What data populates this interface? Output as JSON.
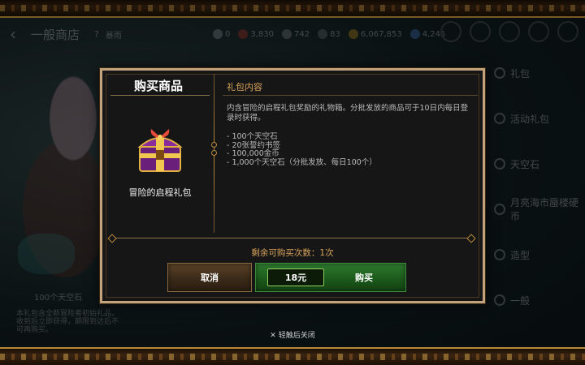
{
  "background": {
    "topbar": {
      "back_icon": "back-arrow-icon",
      "title": "一般商店",
      "help": "?",
      "tag": "暴雨",
      "currencies": [
        {
          "name": "mail",
          "value": "0",
          "color": "#9aa0a8"
        },
        {
          "name": "soul",
          "value": "3,830",
          "color": "#c0392b"
        },
        {
          "name": "ticket",
          "value": "742",
          "color": "#8e8e8e"
        },
        {
          "name": "stone",
          "value": "83",
          "color": "#6f7a80"
        },
        {
          "name": "gold",
          "value": "6,067,853",
          "color": "#d4a020"
        },
        {
          "name": "crystal",
          "value": "4,245",
          "color": "#4a88d8"
        }
      ]
    },
    "left_item": {
      "name": "100个天空石",
      "description": "本礼包含全新冒险者初始礼品，收到后立即获得，期限到达后不可再购买。"
    },
    "sidebar": {
      "items": [
        {
          "label": "礼包"
        },
        {
          "label": "活动礼包"
        },
        {
          "label": "天空石"
        },
        {
          "label": "月亮海市蜃楼硬币"
        },
        {
          "label": "造型"
        },
        {
          "label": "一般"
        }
      ]
    }
  },
  "dialog": {
    "title": "购买商品",
    "item_name": "冒险的启程礼包",
    "content_title": "礼包内容",
    "content_desc": "内含冒险的启程礼包奖励的礼物箱。分批发放的商品可于10日内每日登录时获得。",
    "content_items": [
      "- 100个天空石",
      "- 20张誓约书签",
      "- 100,000金币",
      "- 1,000个天空石（分批发放、每日100个）"
    ],
    "remaining": "剩余可购买次数：1次",
    "cancel_label": "取消",
    "price": "18元",
    "buy_label": "购买"
  },
  "close_hint": "轻触后关闭",
  "close_icon": "close-x-icon",
  "colors": {
    "accent_gold": "#d9a45c",
    "border_gold": "#c2a27a",
    "buy_green": "#1c5a1c",
    "cancel_brown": "#3a2a18"
  }
}
